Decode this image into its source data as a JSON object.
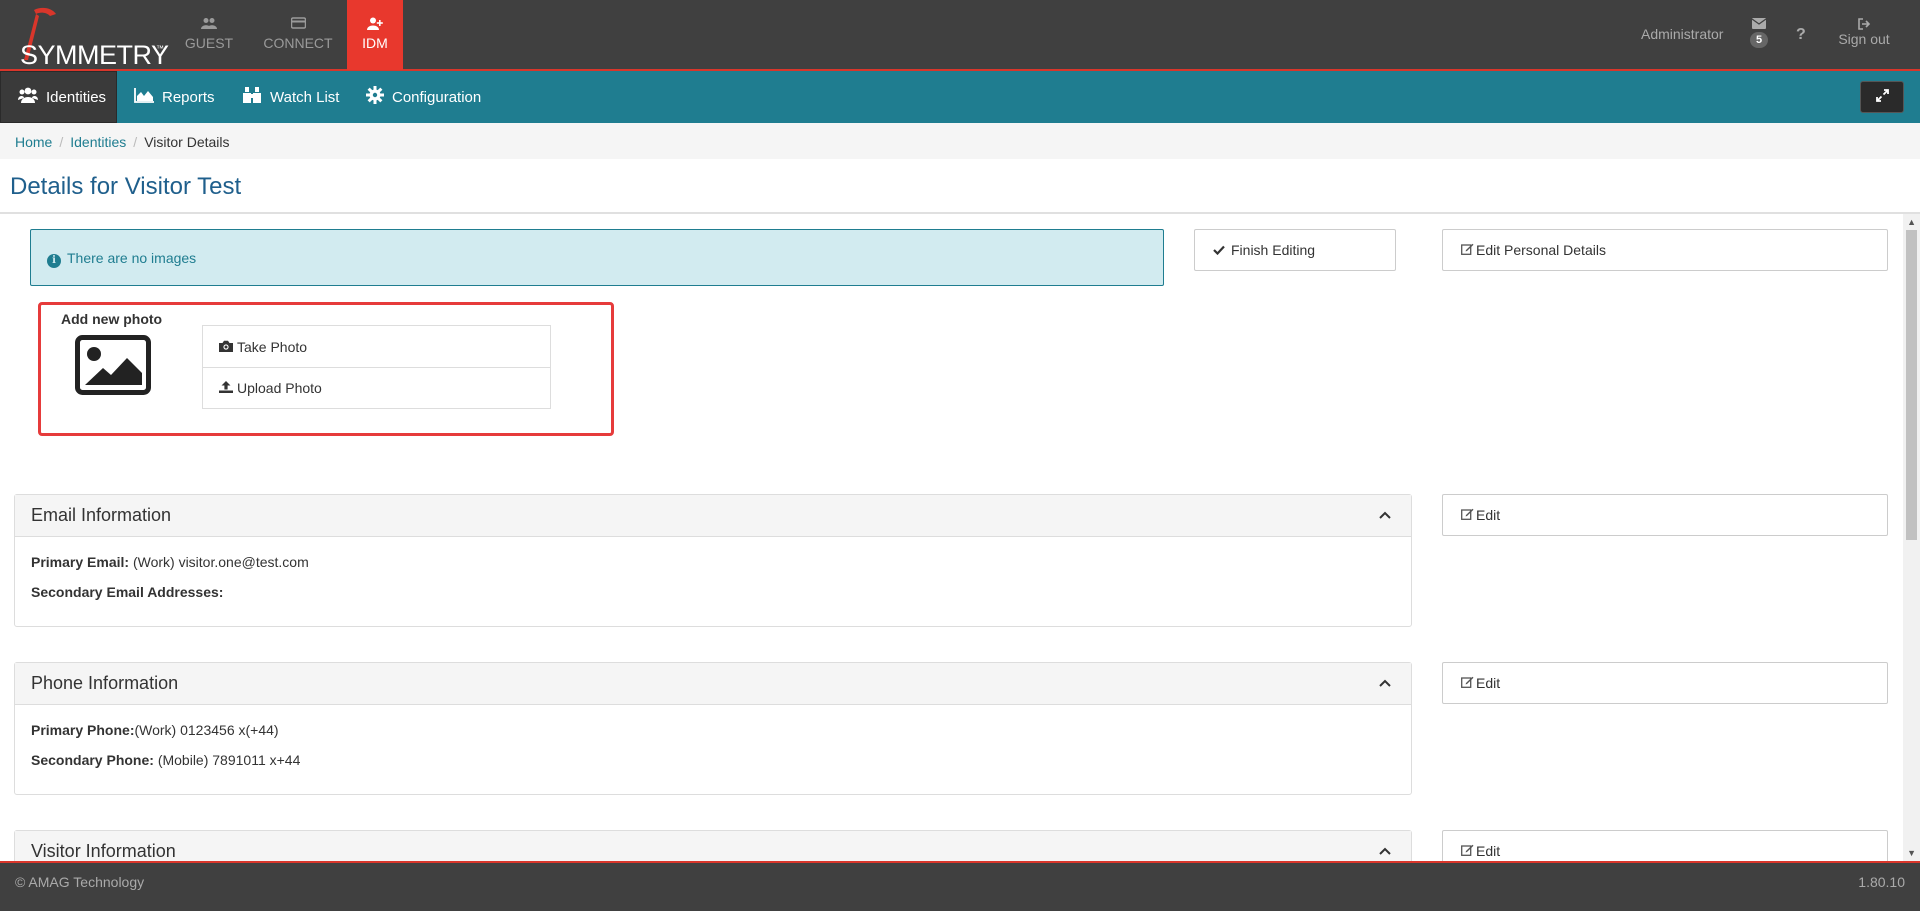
{
  "brand": {
    "name": "SYMMETRY",
    "tm": "™"
  },
  "topnav": [
    {
      "label": "GUEST",
      "icon": "users-icon"
    },
    {
      "label": "CONNECT",
      "icon": "card-icon"
    },
    {
      "label": "IDM",
      "icon": "user-plus-icon",
      "active": true
    }
  ],
  "topright": {
    "user": "Administrator",
    "messages_count": "5",
    "help": "?",
    "signout": "Sign out"
  },
  "subnav": [
    {
      "label": "Identities",
      "icon": "users-icon",
      "active": true
    },
    {
      "label": "Reports",
      "icon": "area-chart-icon"
    },
    {
      "label": "Watch List",
      "icon": "binoculars-icon"
    },
    {
      "label": "Configuration",
      "icon": "gear-icon"
    }
  ],
  "breadcrumb": {
    "home": "Home",
    "identities": "Identities",
    "current": "Visitor Details"
  },
  "page_title": "Details for Visitor Test",
  "alert": {
    "text": "There are no images"
  },
  "actions": {
    "finish_editing": "Finish Editing",
    "edit_personal": "Edit Personal Details",
    "edit": "Edit"
  },
  "photo": {
    "label": "Add new photo",
    "take": "Take Photo",
    "upload": "Upload Photo"
  },
  "email_panel": {
    "title": "Email Information",
    "primary_label": "Primary Email:",
    "primary_value": "(Work) visitor.one@test.com",
    "secondary_label": "Secondary Email Addresses:"
  },
  "phone_panel": {
    "title": "Phone Information",
    "primary_label": "Primary Phone:",
    "primary_value": "(Work) 0123456 x(+44)",
    "secondary_label": "Secondary Phone:",
    "secondary_value": "(Mobile) 7891011 x+44"
  },
  "visitor_panel": {
    "title": "Visitor Information"
  },
  "footer": {
    "copyright": "© AMAG Technology",
    "version": "1.80.10"
  },
  "colors": {
    "accent_red": "#e8382d",
    "teal": "#1f7d90",
    "dark": "#404040"
  }
}
